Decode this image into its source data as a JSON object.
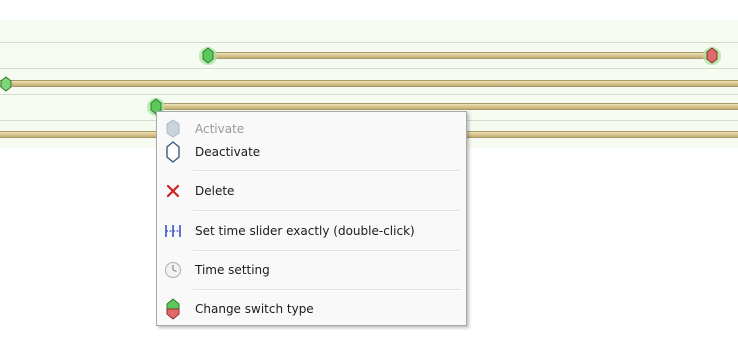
{
  "menu": {
    "activate_label": "Activate",
    "deactivate_label": "Deactivate",
    "delete_label": "Delete",
    "set_time_slider_label": "Set time slider exactly (double-click)",
    "time_setting_label": "Time setting",
    "change_switch_type_label": "Change switch type"
  },
  "icons": {
    "activate": "grey-hexagon-icon",
    "deactivate": "outline-hexagon-icon",
    "delete": "red-x-icon",
    "set_time_slider": "time-slider-icon",
    "time_setting": "clock-icon",
    "change_switch_type": "green-red-switch-icon"
  },
  "colors": {
    "timeline_background": "#f5fbf1",
    "bar": "#d9c58f",
    "switch_on": "#5cc85c",
    "switch_off": "#e06a6a",
    "delete_icon": "#cc2222",
    "slider_icon": "#3a52c8"
  }
}
